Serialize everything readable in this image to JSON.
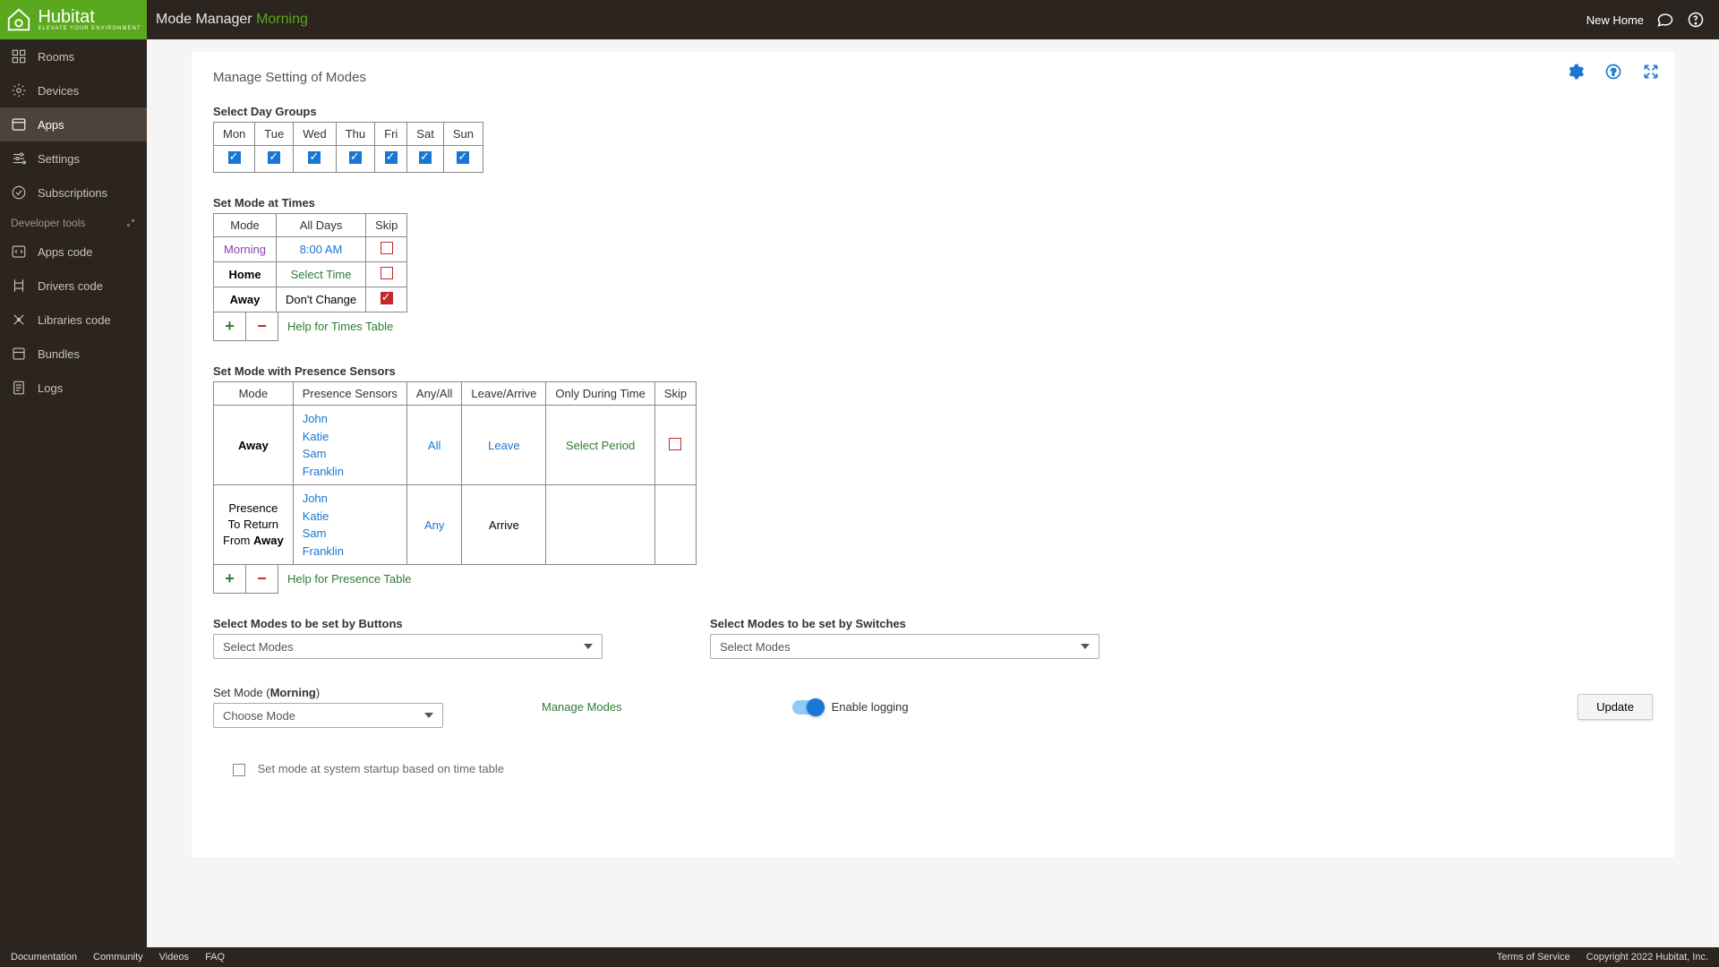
{
  "header": {
    "title_main": "Mode Manager",
    "title_accent": "Morning",
    "home": "New Home"
  },
  "sidebar": {
    "items": [
      {
        "label": "Rooms",
        "icon": "rooms"
      },
      {
        "label": "Devices",
        "icon": "devices"
      },
      {
        "label": "Apps",
        "icon": "apps",
        "active": true
      },
      {
        "label": "Settings",
        "icon": "settings"
      },
      {
        "label": "Subscriptions",
        "icon": "subs"
      }
    ],
    "dev_label": "Developer tools",
    "dev_items": [
      {
        "label": "Apps code",
        "icon": "appscode"
      },
      {
        "label": "Drivers code",
        "icon": "driverscode"
      },
      {
        "label": "Libraries code",
        "icon": "libscode"
      },
      {
        "label": "Bundles",
        "icon": "bundles"
      },
      {
        "label": "Logs",
        "icon": "logs"
      }
    ]
  },
  "page": {
    "title": "Manage Setting of Modes",
    "day_groups_label": "Select Day Groups",
    "days": [
      "Mon",
      "Tue",
      "Wed",
      "Thu",
      "Fri",
      "Sat",
      "Sun"
    ],
    "times_label": "Set Mode at Times",
    "times_headers": [
      "Mode",
      "All Days",
      "Skip"
    ],
    "times_rows": [
      {
        "mode": "Morning",
        "time": "8:00 AM",
        "skip": false,
        "mode_class": "morning"
      },
      {
        "mode": "Home",
        "time": "Select Time",
        "skip": false,
        "mode_class": "bold",
        "time_class": "green"
      },
      {
        "mode": "Away",
        "time": "Don't Change",
        "skip": true,
        "mode_class": "bold"
      }
    ],
    "times_help": "Help for Times Table",
    "presence_label": "Set Mode with Presence Sensors",
    "presence_headers": [
      "Mode",
      "Presence Sensors",
      "Any/All",
      "Leave/Arrive",
      "Only During Time",
      "Skip"
    ],
    "presence_rows": [
      {
        "mode": "Away",
        "mode_kind": "away",
        "sensors": [
          "John",
          "Katie",
          "Sam",
          "Franklin"
        ],
        "anyall": "All",
        "la": "Leave",
        "la_class": "blue",
        "period": "Select Period",
        "skip_shown": true
      },
      {
        "mode": "Presence To Return From Away",
        "mode_kind": "return",
        "sensors": [
          "John",
          "Katie",
          "Sam",
          "Franklin"
        ],
        "anyall": "Any",
        "la": "Arrive",
        "la_class": "",
        "period": "",
        "skip_shown": false
      }
    ],
    "presence_help": "Help for Presence Table",
    "buttons_label": "Select Modes to be set by Buttons",
    "switches_label": "Select Modes to be set by Switches",
    "select_placeholder": "Select Modes",
    "set_mode_label_pre": "Set Mode (",
    "set_mode_label_val": "Morning",
    "set_mode_label_post": ")",
    "choose_mode": "Choose Mode",
    "manage_modes": "Manage Modes",
    "enable_logging": "Enable logging",
    "update": "Update",
    "cutoff": "Set mode at system startup based on time table"
  },
  "footer": {
    "left": [
      "Documentation",
      "Community",
      "Videos",
      "FAQ"
    ],
    "right": [
      "Terms of Service",
      "Copyright 2022 Hubitat, Inc."
    ]
  },
  "brand": {
    "name": "Hubitat",
    "tag": "ELEVATE YOUR ENVIRONMENT"
  }
}
